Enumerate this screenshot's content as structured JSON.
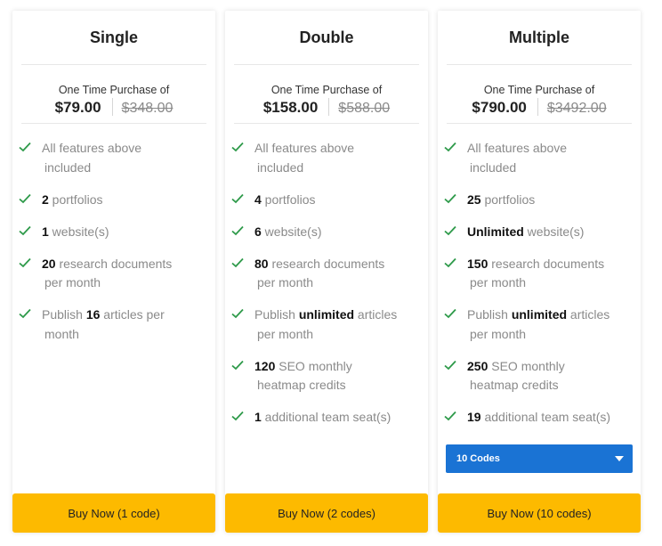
{
  "colors": {
    "accent_button": "#fdba00",
    "check": "#2e9a4a",
    "select": "#1a73d4"
  },
  "plans": [
    {
      "title": "Single",
      "subheading": "One Time Purchase of",
      "price_now": "$79.00",
      "price_was": "$348.00",
      "features": [
        {
          "pre": "All features above",
          "bold": "",
          "post": "",
          "cont": "included"
        },
        {
          "pre": "",
          "bold": "2",
          "post": " portfolios",
          "cont": ""
        },
        {
          "pre": "",
          "bold": "1",
          "post": " website(s)",
          "cont": ""
        },
        {
          "pre": "",
          "bold": "20",
          "post": " research documents",
          "cont": "per month"
        },
        {
          "pre": "Publish ",
          "bold": "16",
          "post": " articles per",
          "cont": "month"
        }
      ],
      "button_label": "Buy Now (1 code)"
    },
    {
      "title": "Double",
      "subheading": "One Time Purchase of",
      "price_now": "$158.00",
      "price_was": "$588.00",
      "features": [
        {
          "pre": "All features above",
          "bold": "",
          "post": "",
          "cont": "included"
        },
        {
          "pre": "",
          "bold": "4",
          "post": " portfolios",
          "cont": ""
        },
        {
          "pre": "",
          "bold": "6",
          "post": " website(s)",
          "cont": ""
        },
        {
          "pre": "",
          "bold": "80",
          "post": " research documents",
          "cont": "per month"
        },
        {
          "pre": "Publish ",
          "bold": "unlimited",
          "post": " articles",
          "cont": "per month"
        },
        {
          "pre": "",
          "bold": "120",
          "post": " SEO monthly",
          "cont": "heatmap credits"
        },
        {
          "pre": "",
          "bold": "1",
          "post": " additional team seat(s)",
          "cont": ""
        }
      ],
      "button_label": "Buy Now (2 codes)"
    },
    {
      "title": "Multiple",
      "subheading": "One Time Purchase of",
      "price_now": "$790.00",
      "price_was": "$3492.00",
      "features": [
        {
          "pre": "All features above",
          "bold": "",
          "post": "",
          "cont": "included"
        },
        {
          "pre": "",
          "bold": "25",
          "post": " portfolios",
          "cont": ""
        },
        {
          "pre": "",
          "bold": "Unlimited",
          "post": " website(s)",
          "cont": ""
        },
        {
          "pre": "",
          "bold": "150",
          "post": " research documents",
          "cont": "per month"
        },
        {
          "pre": "Publish ",
          "bold": "unlimited",
          "post": " articles",
          "cont": "per month"
        },
        {
          "pre": "",
          "bold": "250",
          "post": " SEO monthly",
          "cont": "heatmap credits"
        },
        {
          "pre": "",
          "bold": "19",
          "post": " additional team seat(s)",
          "cont": ""
        }
      ],
      "select_value": "10 Codes",
      "button_label": "Buy Now (10 codes)"
    }
  ]
}
